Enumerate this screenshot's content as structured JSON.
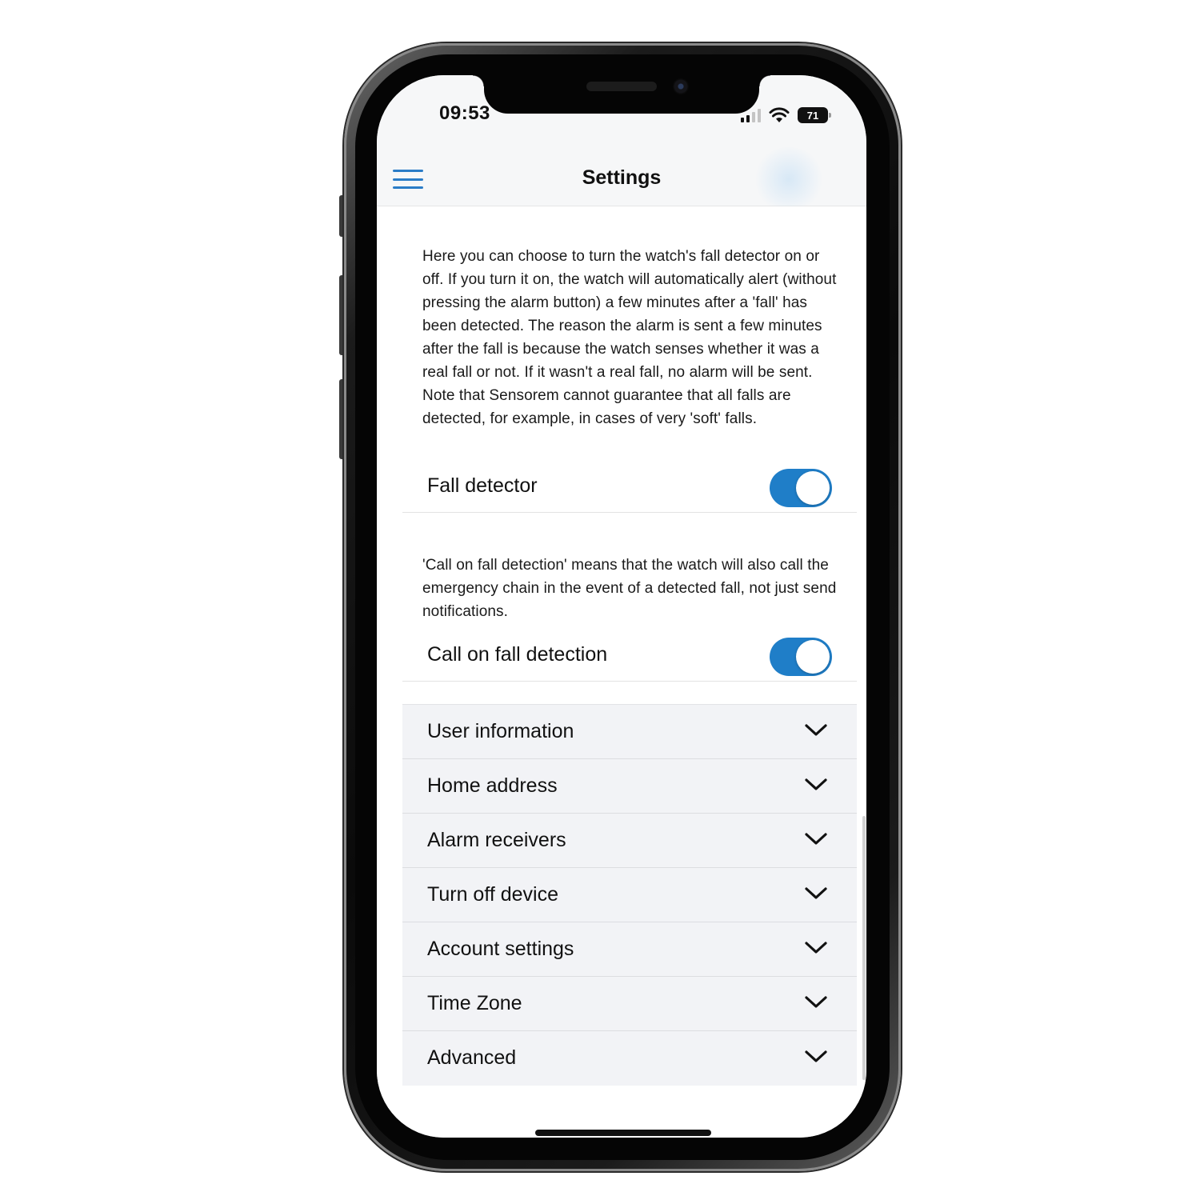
{
  "status_bar": {
    "time": "09:53",
    "battery": "71",
    "icons": [
      "signal-icon",
      "wifi-icon",
      "battery-icon"
    ]
  },
  "header": {
    "title": "Settings",
    "menu_icon": "hamburger-menu-icon"
  },
  "fall_section": {
    "description": "Here you can choose to turn the watch's fall detector on or off. If you turn it on, the watch will automatically alert (without pressing the alarm button) a few minutes after a 'fall' has been detected. The reason the alarm is sent a few minutes after the fall is because the watch senses whether it was a real fall or not. If it wasn't a real fall, no alarm will be sent. Note that Sensorem cannot guarantee that all falls are detected, for example, in cases of very 'soft' falls.",
    "toggle_label": "Fall detector",
    "toggle_on": true
  },
  "call_section": {
    "description": "'Call on fall detection' means that the watch will also call the emergency chain in the event of a detected fall, not just send notifications.",
    "toggle_label": "Call on fall detection",
    "toggle_on": true
  },
  "accordion": {
    "items": [
      {
        "label": "User information"
      },
      {
        "label": "Home address"
      },
      {
        "label": "Alarm receivers"
      },
      {
        "label": "Turn off device"
      },
      {
        "label": "Account settings"
      },
      {
        "label": "Time Zone"
      },
      {
        "label": "Advanced"
      }
    ],
    "icon": "chevron-down-icon"
  },
  "colors": {
    "accent": "#1f7ec8",
    "menu_icon": "#2a7cc7",
    "accordion_bg": "#f2f3f6"
  }
}
